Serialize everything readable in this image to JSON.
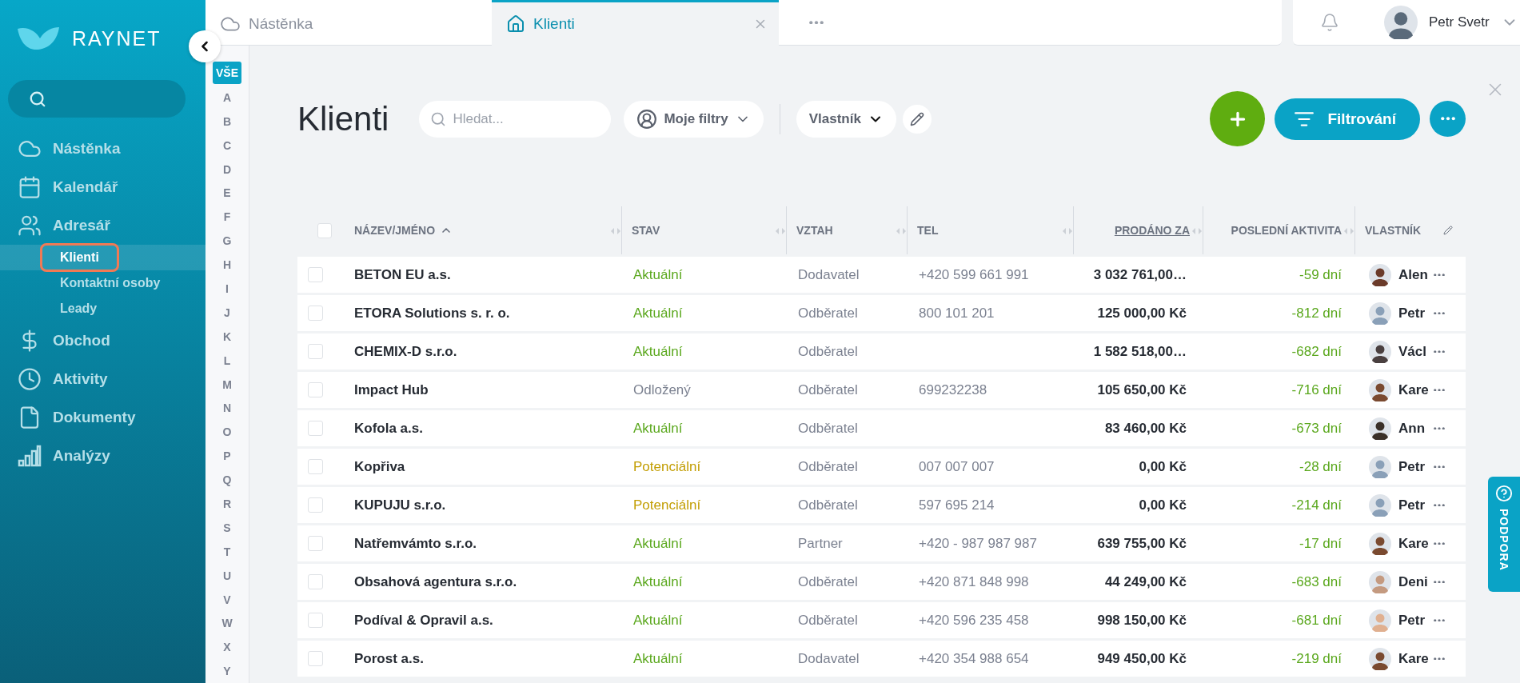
{
  "sidebar": {
    "logo": "RAYNET",
    "items": [
      {
        "label": "Nástěnka",
        "selected": false
      },
      {
        "label": "Kalendář",
        "selected": false
      },
      {
        "label": "Adresář",
        "selected": false,
        "children": [
          {
            "label": "Klienti",
            "selected": true
          },
          {
            "label": "Kontaktní osoby",
            "selected": false
          },
          {
            "label": "Leady",
            "selected": false
          }
        ]
      },
      {
        "label": "Obchod",
        "selected": false
      },
      {
        "label": "Aktivity",
        "selected": false
      },
      {
        "label": "Dokumenty",
        "selected": false
      },
      {
        "label": "Analýzy",
        "selected": false
      }
    ]
  },
  "alphabet": [
    {
      "label": "VŠE",
      "selected": true
    },
    {
      "label": "A",
      "selected": false
    },
    {
      "label": "B",
      "selected": false
    },
    {
      "label": "C",
      "selected": false
    },
    {
      "label": "D",
      "selected": false
    },
    {
      "label": "E",
      "selected": false
    },
    {
      "label": "F",
      "selected": false
    },
    {
      "label": "G",
      "selected": false
    },
    {
      "label": "H",
      "selected": false
    },
    {
      "label": "I",
      "selected": false
    },
    {
      "label": "J",
      "selected": false
    },
    {
      "label": "K",
      "selected": false
    },
    {
      "label": "L",
      "selected": false
    },
    {
      "label": "M",
      "selected": false
    },
    {
      "label": "N",
      "selected": false
    },
    {
      "label": "O",
      "selected": false
    },
    {
      "label": "P",
      "selected": false
    },
    {
      "label": "Q",
      "selected": false
    },
    {
      "label": "R",
      "selected": false
    },
    {
      "label": "S",
      "selected": false
    },
    {
      "label": "T",
      "selected": false
    },
    {
      "label": "U",
      "selected": false
    },
    {
      "label": "V",
      "selected": false
    },
    {
      "label": "W",
      "selected": false
    },
    {
      "label": "X",
      "selected": false
    },
    {
      "label": "Y",
      "selected": false
    }
  ],
  "tabs": [
    {
      "label": "Nástěnka",
      "selected": false
    },
    {
      "label": "Klienti",
      "selected": true
    }
  ],
  "user": {
    "name": "Petr Svetr"
  },
  "page": {
    "title": "Klienti",
    "search": {
      "placeholder": "Hledat..."
    },
    "my_filters": "Moje filtry",
    "owner_dropdown": "Vlastník",
    "filter_button": "Filtrování"
  },
  "support_tab": "PODPORA",
  "table": {
    "all_checked": false,
    "columns": [
      {
        "label": "NÁZEV/JMÉNO",
        "sorted_ascending": true
      },
      {
        "label": "STAV"
      },
      {
        "label": "VZTAH"
      },
      {
        "label": "TEL"
      },
      {
        "label": "PRODÁNO ZA",
        "underlined": true
      },
      {
        "label": "POSLEDNÍ AKTIVITA"
      },
      {
        "label": "VLASTNÍK"
      }
    ],
    "rows": [
      {
        "checked": false,
        "name": "BETON EU a.s.",
        "status": {
          "text": "Aktuální",
          "color": "#5ba81e"
        },
        "relation": "Dodavatel",
        "tel": "+420 599 661 991",
        "sold": "3 032 761,00…",
        "last_activity": "-59 dní",
        "owner": "Alen"
      },
      {
        "checked": false,
        "name": "ETORA Solutions s. r. o.",
        "status": {
          "text": "Aktuální",
          "color": "#5ba81e"
        },
        "relation": "Odběratel",
        "tel": "800 101 201",
        "sold": "125 000,00 Kč",
        "last_activity": "-812 dní",
        "owner": "Petr"
      },
      {
        "checked": false,
        "name": "CHEMIX-D s.r.o.",
        "status": {
          "text": "Aktuální",
          "color": "#5ba81e"
        },
        "relation": "Odběratel",
        "sold": "1 582 518,00…",
        "last_activity": "-682 dní",
        "owner": "Václ"
      },
      {
        "checked": false,
        "name": "Impact Hub",
        "status": {
          "text": "Odložený",
          "color": "#7b8190"
        },
        "relation": "Odběratel",
        "tel": "699232238",
        "sold": "105 650,00 Kč",
        "last_activity": "-716 dní",
        "owner": "Kare"
      },
      {
        "checked": false,
        "name": "Kofola a.s.",
        "status": {
          "text": "Aktuální",
          "color": "#5ba81e"
        },
        "relation": "Odběratel",
        "sold": "83 460,00 Kč",
        "last_activity": "-673 dní",
        "owner": "Ann"
      },
      {
        "checked": false,
        "name": "Kopřiva",
        "status": {
          "text": "Potenciální",
          "color": "#c29d00"
        },
        "relation": "Odběratel",
        "tel": "007 007 007",
        "sold": "0,00 Kč",
        "last_activity": "-28 dní",
        "owner": "Petr"
      },
      {
        "checked": false,
        "name": "KUPUJU s.r.o.",
        "status": {
          "text": "Potenciální",
          "color": "#c29d00"
        },
        "relation": "Odběratel",
        "tel": "597 695 214",
        "sold": "0,00 Kč",
        "last_activity": "-214 dní",
        "owner": "Petr"
      },
      {
        "checked": false,
        "name": "Natřemvámto s.r.o.",
        "status": {
          "text": "Aktuální",
          "color": "#5ba81e"
        },
        "relation": "Partner",
        "tel": "+420 - 987 987 987",
        "sold": "639 755,00 Kč",
        "last_activity": "-17 dní",
        "owner": "Kare"
      },
      {
        "checked": false,
        "name": "Obsahová agentura s.r.o.",
        "status": {
          "text": "Aktuální",
          "color": "#5ba81e"
        },
        "relation": "Odběratel",
        "tel": "+420 871 848 998",
        "sold": "44 249,00 Kč",
        "last_activity": "-683 dní",
        "owner": "Deni"
      },
      {
        "checked": false,
        "name": "Podíval & Opravil a.s.",
        "status": {
          "text": "Aktuální",
          "color": "#5ba81e"
        },
        "relation": "Odběratel",
        "tel": "+420 596 235 458",
        "sold": "998 150,00 Kč",
        "last_activity": "-681 dní",
        "owner": "Petr"
      },
      {
        "checked": false,
        "name": "Porost a.s.",
        "status": {
          "text": "Aktuální",
          "color": "#5ba81e"
        },
        "relation": "Dodavatel",
        "tel": "+420 354 988 654",
        "sold": "949 450,00 Kč",
        "last_activity": "-219 dní",
        "owner": "Kare"
      }
    ]
  }
}
